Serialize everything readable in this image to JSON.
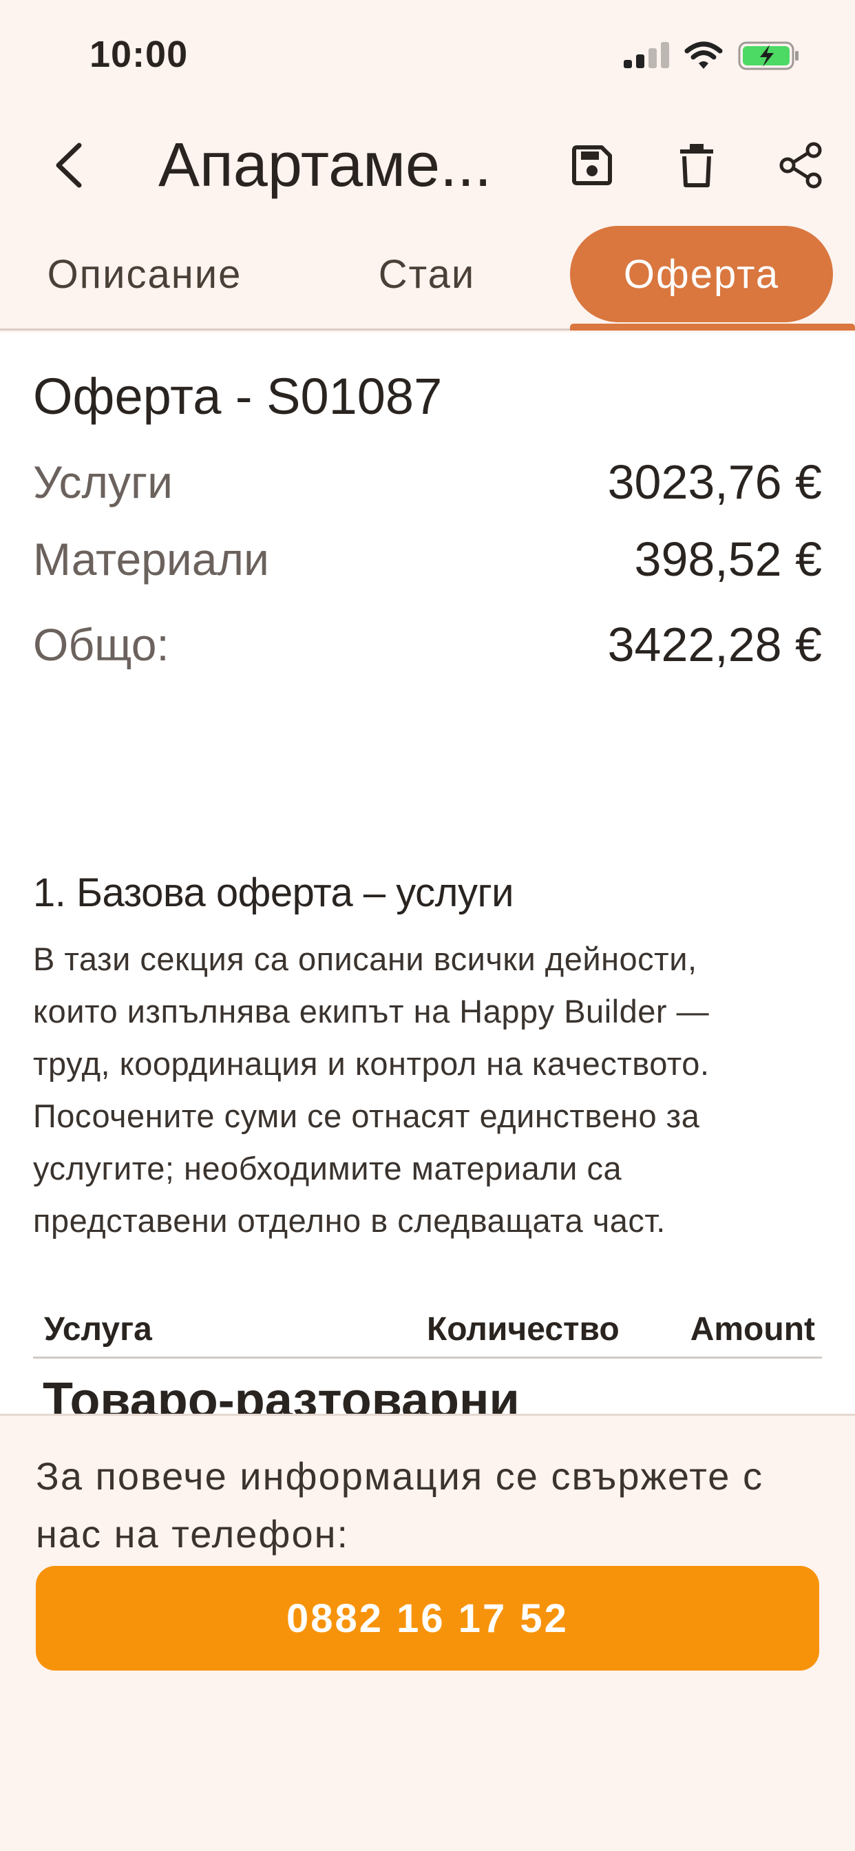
{
  "status_bar": {
    "time": "10:00"
  },
  "header": {
    "title": "Апартаме...",
    "icons": [
      "back-arrow-icon",
      "save-icon",
      "trash-icon",
      "share-icon"
    ]
  },
  "tabs": [
    {
      "label": "Описание",
      "active": false
    },
    {
      "label": "Стаи",
      "active": false
    },
    {
      "label": "Оферта",
      "active": true
    }
  ],
  "offer": {
    "title": "Оферта - S01087",
    "rows": [
      {
        "label": "Услуги",
        "value": "3023,76 €"
      },
      {
        "label": "Материали",
        "value": "398,52 €"
      },
      {
        "label": "Общо:",
        "value": "3422,28 €"
      }
    ]
  },
  "section": {
    "title": "1. Базова оферта – услуги",
    "lines": [
      "В тази секция са описани всички дейности,",
      "които изпълнява екипът на Happy Builder —",
      "труд, координация и контрол на качеството.",
      "Посочените суми се отнасят единствено за",
      "услугите; необходимите материали са",
      "представени отделно в следващата част."
    ]
  },
  "table": {
    "headers": [
      "Услуга",
      "Количество",
      "Amount"
    ],
    "first_row_label": "Товаро-разтоварни"
  },
  "footer": {
    "text_lines": [
      "За повече информация се свържете с",
      "нас на телефон:"
    ],
    "phone": "0882 16 17 52"
  },
  "colors": {
    "background": "#fdf3ef",
    "accent_tab": "#d9773f",
    "call_button": "#f7930a",
    "battery": "#4cd964"
  }
}
